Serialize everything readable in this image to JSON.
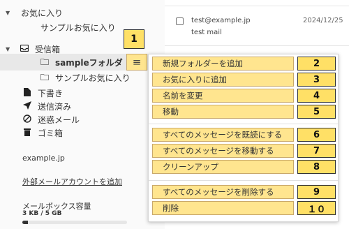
{
  "sidebar": {
    "favorites": {
      "label": "お気に入り",
      "item": "サンプルお気に入り"
    },
    "inbox": {
      "label": "受信箱"
    },
    "folders": [
      {
        "label": "sampleフォルダ"
      },
      {
        "label": "サンプルお気に入り"
      }
    ],
    "drafts": "下書き",
    "sent": "送信済み",
    "spam": "迷惑メール",
    "trash": "ゴミ箱",
    "account": "example.jp",
    "add_external": "外部メールアカウントを追加",
    "quota": {
      "title": "メールボックス容量",
      "usage": "3 KB / 5 GB",
      "fraction": 0.05
    }
  },
  "kebab_callout": "1",
  "mail": {
    "from": "test@example.jp",
    "subject": "test mail",
    "date": "2024/12/25"
  },
  "menu": {
    "groups": [
      [
        {
          "label": "新規フォルダーを追加",
          "num": "2"
        },
        {
          "label": "お気に入りに追加",
          "num": "3"
        },
        {
          "label": "名前を変更",
          "num": "4"
        },
        {
          "label": "移動",
          "num": "5"
        }
      ],
      [
        {
          "label": "すべてのメッセージを既読にする",
          "num": "6"
        },
        {
          "label": "すべてのメッセージを移動する",
          "num": "7"
        },
        {
          "label": "クリーンアップ",
          "num": "8"
        }
      ],
      [
        {
          "label": "すべてのメッセージを削除する",
          "num": "9"
        },
        {
          "label": "削除",
          "num": "１０"
        }
      ]
    ]
  },
  "colors": {
    "highlight": "#ffe58f",
    "callout": "#ffe066",
    "selected_row": "#e8e8e8"
  },
  "icons": {
    "inbox": "inbox-icon",
    "folder": "folder-icon",
    "drafts": "file-icon",
    "sent": "send-icon",
    "spam": "ban-icon",
    "trash": "trash-icon",
    "menu": "hamburger-icon"
  }
}
